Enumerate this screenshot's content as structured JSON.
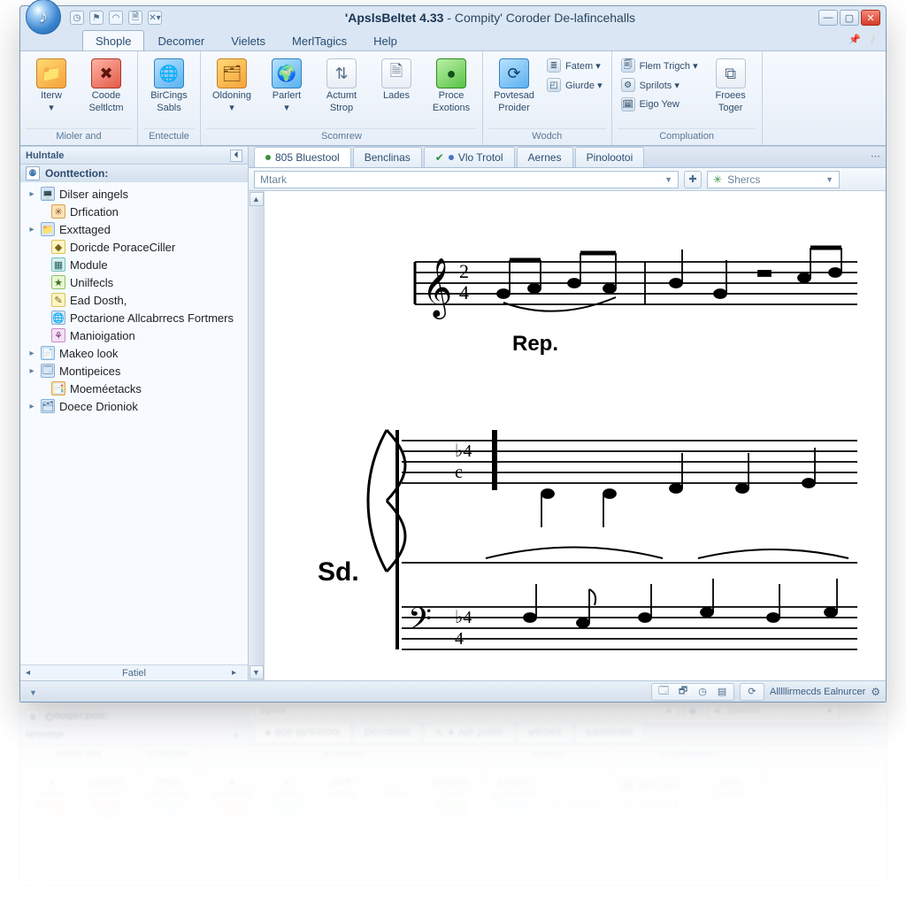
{
  "title": {
    "app": "'ApslsBeltet 4.33",
    "doc": " - Compity' Coroder De-lafincehalls"
  },
  "ribbon_tabs": [
    "Shople",
    "Decomer",
    "Vielets",
    "MerlTagics",
    "Help"
  ],
  "ribbon": {
    "g1": {
      "label": "Mioler and",
      "b1": "Iterw",
      "b2a": "Coode",
      "b2b": "Seltlctm"
    },
    "g2": {
      "label": "Entectule",
      "b1a": "BirCings",
      "b1b": "Sabls"
    },
    "g3": {
      "label": "Scomrew",
      "b1": "Oldoning",
      "b2": "Parlert",
      "b3a": "Actumt",
      "b3b": "Strop",
      "b4": "Lades",
      "b5a": "Proce",
      "b5b": "Exotions"
    },
    "g4": {
      "label": "Wodch",
      "b1a": "Povtesad",
      "b1b": "Proider",
      "m1": "Fatem ▾",
      "m2": "Giurde ▾"
    },
    "g5": {
      "label": "Compluation",
      "m1": "Flem Trigch ▾",
      "m2": "Sprilots ▾",
      "m3": "Eigo Yew",
      "b1a": "Froees",
      "b1b": "Toger"
    }
  },
  "sidebar": {
    "panel_title": "Hulntale",
    "section": "Oonttection:",
    "footer": "Fatiel",
    "items": [
      {
        "exp": "▸",
        "ic": "c0",
        "g": "💻",
        "label": "Dilser aingels"
      },
      {
        "exp": "",
        "ic": "c1",
        "g": "✳",
        "label": "Drfication"
      },
      {
        "exp": "▸",
        "ic": "c0",
        "g": "📁",
        "label": "Exxttaged"
      },
      {
        "exp": "",
        "ic": "c4",
        "g": "◆",
        "label": "Doricde PoraceCiller"
      },
      {
        "exp": "",
        "ic": "c5",
        "g": "▦",
        "label": "Module"
      },
      {
        "exp": "",
        "ic": "c2",
        "g": "★",
        "label": "Unilfecls"
      },
      {
        "exp": "",
        "ic": "c4",
        "g": "✎",
        "label": "Ead Dosth,"
      },
      {
        "exp": "",
        "ic": "c0",
        "g": "🌐",
        "label": "Poctarione Allcabrrecs Fortmers"
      },
      {
        "exp": "",
        "ic": "c3",
        "g": "⚘",
        "label": "Manioigation"
      },
      {
        "exp": "▸",
        "ic": "c0",
        "g": "📄",
        "label": "Makeo look"
      },
      {
        "exp": "▸",
        "ic": "c0",
        "g": "🗔",
        "label": "Montipeices"
      },
      {
        "exp": "",
        "ic": "c1",
        "g": "📑",
        "label": "Moeméetacks"
      },
      {
        "exp": "▸",
        "ic": "c0",
        "g": "🗂",
        "label": "Doece Drioniok"
      }
    ]
  },
  "doc_tabs": [
    {
      "label": "805 Bluestool",
      "active": true,
      "dot": "#3a8f3d"
    },
    {
      "label": "Benclinas",
      "active": false,
      "dot": ""
    },
    {
      "label": "Vlo Trotol",
      "active": false,
      "dot": "#4a74c1",
      "check": true
    },
    {
      "label": "Aernes",
      "active": false,
      "dot": ""
    },
    {
      "label": "Pinolootoi",
      "active": false,
      "dot": ""
    }
  ],
  "toolbar": {
    "combo1": "Mtark",
    "combo2": "Shercs"
  },
  "score": {
    "marking1": "Rep.",
    "marking2": "Sd."
  },
  "status": {
    "right_label": "Alllllirmecds Ealnurcer"
  }
}
